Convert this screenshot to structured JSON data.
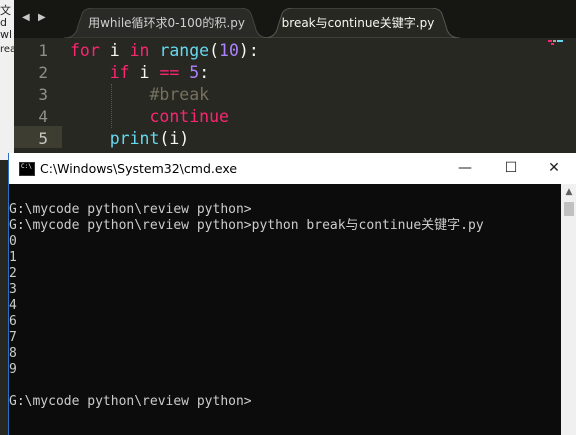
{
  "left_strip": {
    "fragments": [
      "文",
      "d",
      "wl",
      "rea"
    ]
  },
  "editor": {
    "tabs": [
      {
        "label": "用while循环求0-100的积.py",
        "close": "×",
        "active": false
      },
      {
        "label": "break与continue关键字.py",
        "close": "×",
        "active": true
      }
    ],
    "nav": {
      "back": "◀",
      "forward": "▶"
    },
    "line_numbers": [
      "1",
      "2",
      "3",
      "4",
      "5"
    ],
    "code": {
      "l1": {
        "kw1": "for",
        "t1": " i ",
        "kw2": "in",
        "t2": " ",
        "fn": "range",
        "t3": "(",
        "num": "10",
        "t4": "):"
      },
      "l2": {
        "ind": "    ",
        "kw": "if",
        "t1": " i ",
        "op": "==",
        "t2": " ",
        "num": "5",
        "t3": ":"
      },
      "l3": {
        "ind": "        ",
        "cm": "#break"
      },
      "l4": {
        "ind": "        ",
        "kw": "continue"
      },
      "l5": {
        "ind": "    ",
        "fn": "print",
        "t": "(i)"
      }
    }
  },
  "cmd": {
    "title": "C:\\Windows\\System32\\cmd.exe",
    "icon_text": "C:\\",
    "buttons": {
      "minimize": "—",
      "maximize": "☐",
      "close": "✕"
    },
    "lines": [
      "",
      "G:\\mycode python\\review python>",
      "G:\\mycode python\\review python>python break与continue关键字.py",
      "0",
      "1",
      "2",
      "3",
      "4",
      "6",
      "7",
      "8",
      "9",
      "",
      "G:\\mycode python\\review python>"
    ],
    "scroll_up": "▲"
  },
  "colors": {
    "editor_bg": "#272822",
    "keyword": "#f92672",
    "function": "#66d9ef",
    "number": "#ae81ff",
    "comment": "#75715e",
    "console_bg": "#0c0c0c",
    "console_text": "#cccccc"
  }
}
